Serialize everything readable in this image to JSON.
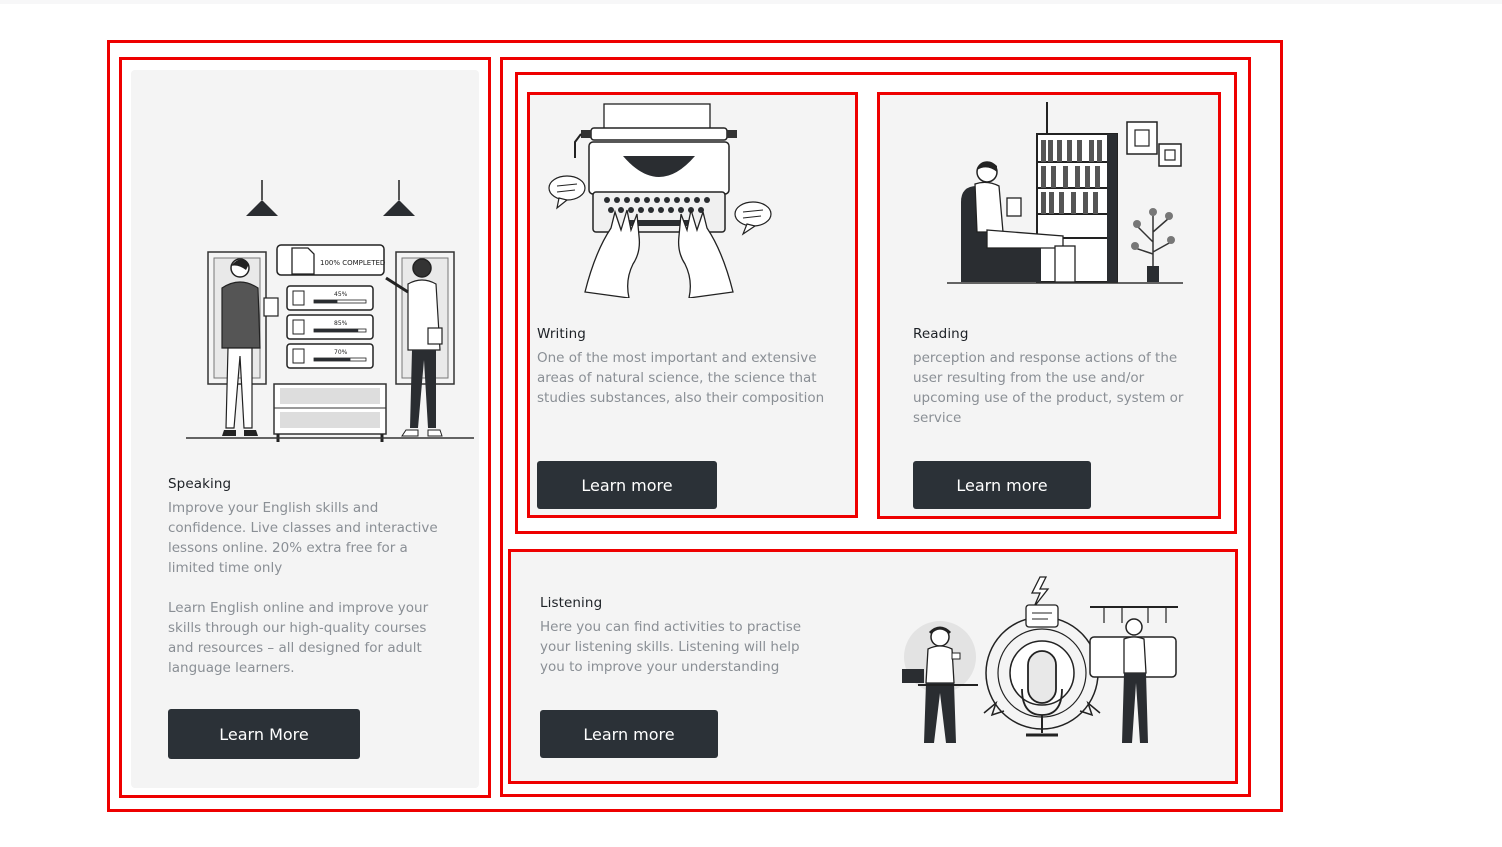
{
  "cards": {
    "speaking": {
      "title": "Speaking",
      "description_1": "Improve your English skills and confidence. Live classes and interactive lessons online. 20% extra free for a limited time only",
      "description_2": "Learn English online and improve your skills through our high-quality courses and resources – all designed for adult language learners.",
      "button_label": "Learn More",
      "illustration": {
        "icon": "progress-board-illustration",
        "completed_label": "100% COMPLETED",
        "bars": [
          {
            "label": "45%",
            "value": 0.45
          },
          {
            "label": "85%",
            "value": 0.85
          },
          {
            "label": "70%",
            "value": 0.7
          }
        ]
      }
    },
    "writing": {
      "title": "Writing",
      "description": "One of the most important and extensive areas of natural science, the science that studies substances, also their composition",
      "button_label": "Learn more",
      "illustration_icon": "typewriter-illustration"
    },
    "reading": {
      "title": "Reading",
      "description": "perception and response actions of the user resulting from the use and/or upcoming use of the product, system or service",
      "button_label": "Learn more",
      "illustration_icon": "reading-chair-illustration"
    },
    "listening": {
      "title": "Listening",
      "description": "Here you can find activities to practise your listening skills. Listening will help you to improve your understanding",
      "button_label": "Learn more",
      "illustration_icon": "microphone-listeners-illustration"
    }
  },
  "colors": {
    "outline": "#ee0000",
    "card_background": "#f4f4f4",
    "button": "#2b3137",
    "text_dark": "#1d2126",
    "text_muted": "#8a8f95"
  }
}
